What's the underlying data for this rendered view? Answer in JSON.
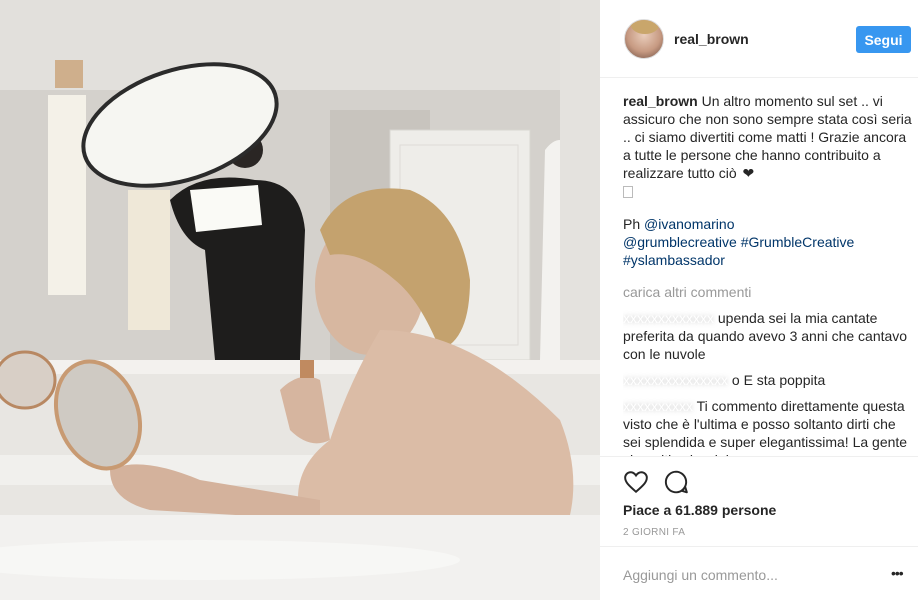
{
  "post": {
    "username": "real_brown",
    "follow_label": "Segui",
    "caption_user": "real_brown",
    "caption_text": "Un altro momento sul set .. vi assicuro che non sono sempre stata così seria .. ci siamo divertiti come matti ! Grazie ancora a tutte le persone che hanno contribuito a realizzare tutto ciò",
    "caption_heart": "❤",
    "credit_prefix": "Ph",
    "credit_mention": "@ivanomarino",
    "credit_line2_mention": "@grumblecreative",
    "credit_hashtag1": "#GrumbleCreative",
    "credit_hashtag2": "#yslambassador",
    "load_more": "carica altri commenti",
    "comments": [
      {
        "text": "upenda sei la mia cantate preferita da quando avevo 3 anni che cantavo con le nuvole"
      },
      {
        "text": "o E sta poppita"
      },
      {
        "text": "Ti commento direttamente questa visto che è l'ultima e posso soltanto dirti che sei splendida e super elegantissima! La gente che critica lasciala"
      }
    ],
    "likes": "Piace a 61.889 persone",
    "time": "2 GIORNI FA",
    "add_comment_placeholder": "Aggiungi un commento...",
    "more_options": "•••"
  },
  "icons": {
    "like": "heart-icon",
    "comment": "comment-icon",
    "options": "more-options-icon"
  },
  "colors": {
    "accent": "#3897f0",
    "link": "#003569",
    "muted": "#999999"
  }
}
